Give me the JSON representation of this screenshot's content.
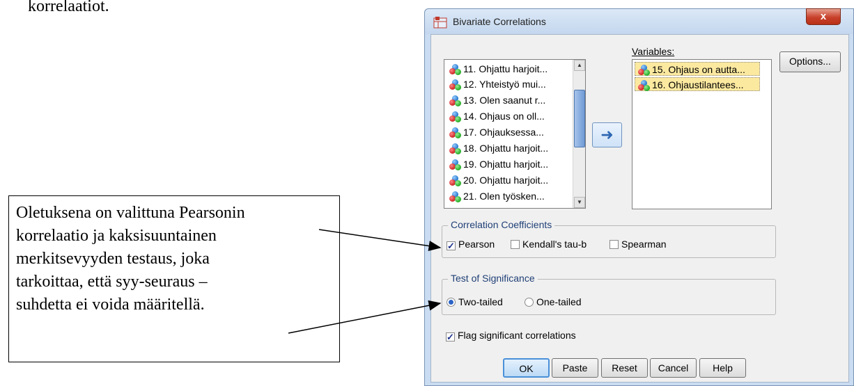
{
  "document": {
    "top_text": "korrelaatiot.",
    "callout_lines": [
      "Oletuksena on valittuna Pearsonin",
      "korrelaatio ja kaksisuuntainen",
      "merkitsevyyden testaus, joka",
      "tarkoittaa, että syy-seuraus –",
      "suhdetta ei voida määritellä."
    ]
  },
  "dialog": {
    "title": "Bivariate Correlations",
    "close_label": "x",
    "source_variables": [
      "11. Ohjattu harjoit...",
      "12. Yhteistyö mui...",
      "13. Olen saanut r...",
      "14. Ohjaus on oll...",
      "17. Ohjauksessa...",
      "18. Ohjattu harjoit...",
      "19. Ohjattu harjoit...",
      "20. Ohjattu harjoit...",
      "21. Olen työsken..."
    ],
    "variables_label": "Variables:",
    "selected_variables": [
      "15. Ohjaus on autta...",
      "16. Ohjaustilantees..."
    ],
    "move_icon": "arrow-left-icon",
    "options_label": "Options...",
    "correlation_coefficients": {
      "title": "Correlation Coefficients",
      "pearson": {
        "label": "Pearson",
        "checked": true
      },
      "kendall": {
        "label": "Kendall's tau-b",
        "checked": false
      },
      "spearman": {
        "label": "Spearman",
        "checked": false
      }
    },
    "test_of_significance": {
      "title": "Test of Significance",
      "two_tailed": {
        "label": "Two-tailed",
        "selected": true
      },
      "one_tailed": {
        "label": "One-tailed",
        "selected": false
      }
    },
    "flag_significant": {
      "label": "Flag significant correlations",
      "checked": true
    },
    "buttons": {
      "ok": "OK",
      "paste": "Paste",
      "reset": "Reset",
      "cancel": "Cancel",
      "help": "Help"
    }
  },
  "colors": {
    "title_bar": "#c9dcf1",
    "close_button": "#c8402a",
    "selected_item": "#fce9a0",
    "group_title": "#1f3f76"
  }
}
